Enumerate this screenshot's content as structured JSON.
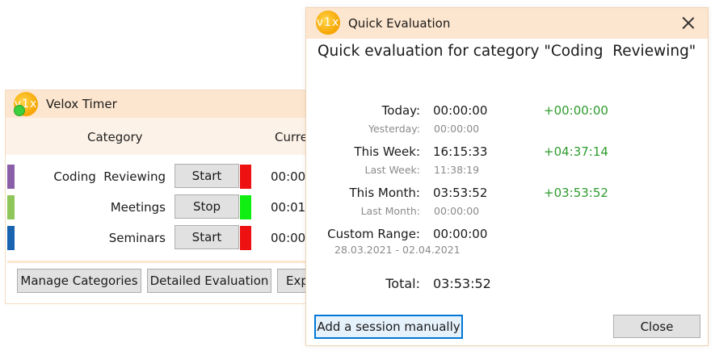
{
  "main_window": {
    "logo_text": "v1x",
    "title": "Velox Timer",
    "columns": {
      "category": "Category",
      "current": "Curre"
    },
    "rows": [
      {
        "name": "Coding  Reviewing",
        "button": "Start",
        "time": "00:00:0",
        "category_color": "#8b5fa8",
        "state_color": "#ee1111"
      },
      {
        "name": "Meetings",
        "button": "Stop",
        "time": "00:01:0",
        "category_color": "#8fc65a",
        "state_color": "#11ee11"
      },
      {
        "name": "Seminars",
        "button": "Start",
        "time": "00:00:0",
        "category_color": "#1a63b0",
        "state_color": "#ee1111"
      }
    ],
    "footer": {
      "manage": "Manage Categories",
      "detailed": "Detailed Evaluation",
      "export": "Exp"
    }
  },
  "dialog": {
    "logo_text": "v1x",
    "title": "Quick Evaluation",
    "heading": "Quick evaluation for category \"Coding  Reviewing\"",
    "today": {
      "label": "Today:",
      "value": "00:00:00",
      "diff": "+00:00:00"
    },
    "yesterday": {
      "label": "Yesterday:",
      "value": "00:00:00"
    },
    "this_week": {
      "label": "This Week:",
      "value": "16:15:33",
      "diff": "+04:37:14"
    },
    "last_week": {
      "label": "Last Week:",
      "value": "11:38:19"
    },
    "this_month": {
      "label": "This Month:",
      "value": "03:53:52",
      "diff": "+03:53:52"
    },
    "last_month": {
      "label": "Last Month:",
      "value": "00:00:00"
    },
    "custom_range": {
      "label": "Custom Range:",
      "value": "00:00:00",
      "dates": "28.03.2021 - 02.04.2021"
    },
    "total": {
      "label": "Total:",
      "value": "03:53:52"
    },
    "add_button": "Add a session manually",
    "close_button": "Close"
  },
  "colors": {
    "titlebar": "#fde6cf",
    "header_band": "#fdf2e7",
    "positive_diff": "#2e9b2e",
    "focus_border": "#0078d7"
  }
}
